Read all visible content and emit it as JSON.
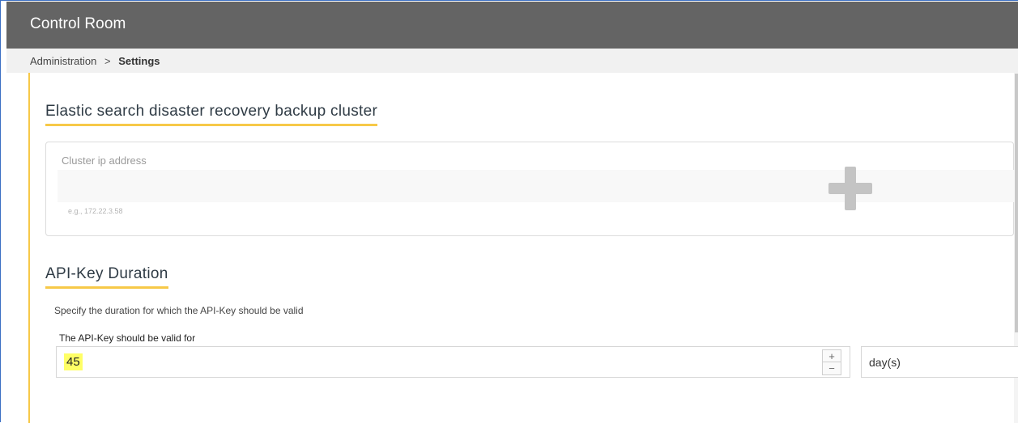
{
  "app": {
    "title": "Control Room"
  },
  "breadcrumb": {
    "parent": "Administration",
    "separator": ">",
    "current": "Settings"
  },
  "elastic": {
    "title": "Elastic search disaster recovery backup cluster",
    "field_label": "Cluster ip address",
    "value": "",
    "hint": "e.g., 172.22.3.58",
    "add_icon": "plus-icon"
  },
  "api_key": {
    "title": "API-Key Duration",
    "description": "Specify the duration for which the API-Key should be valid",
    "field_label": "The API-Key should be valid for",
    "duration_value": "45",
    "stepper_up": "+",
    "stepper_down": "−",
    "unit": "day(s)"
  },
  "colors": {
    "accent": "#f7c948",
    "titlebar": "#646464",
    "highlight": "#ffff66"
  }
}
